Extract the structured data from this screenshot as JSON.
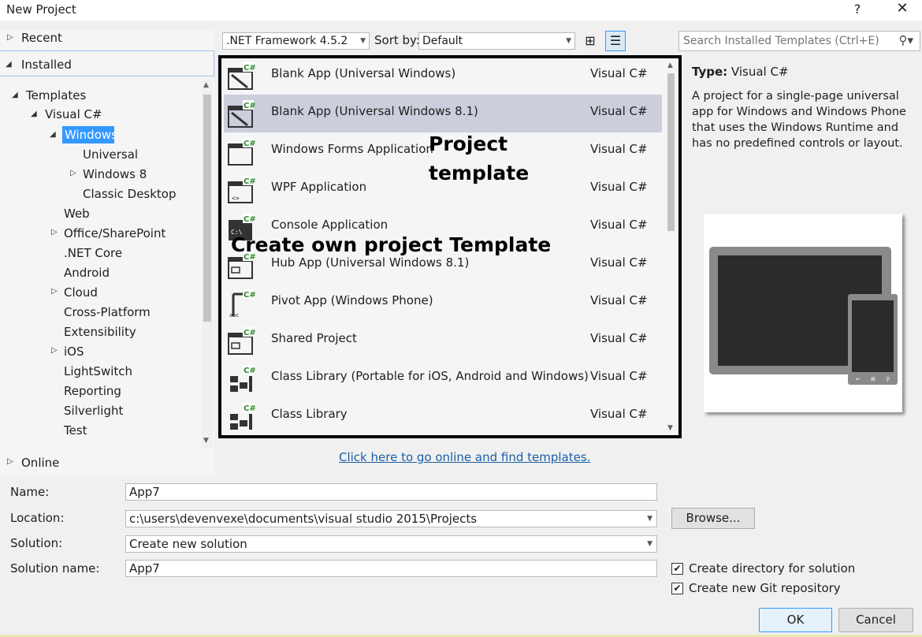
{
  "window": {
    "title": "New Project",
    "help": "?",
    "close": "✕"
  },
  "tree": {
    "recent": "Recent",
    "installed": "Installed",
    "templates": "Templates",
    "visual_csharp": "Visual C#",
    "windows": "Windows",
    "universal": "Universal",
    "windows8": "Windows 8",
    "classic_desktop": "Classic Desktop",
    "web": "Web",
    "office_sharepoint": "Office/SharePoint",
    "net_core": ".NET Core",
    "android": "Android",
    "cloud": "Cloud",
    "cross_platform": "Cross-Platform",
    "extensibility": "Extensibility",
    "ios": "iOS",
    "lightswitch": "LightSwitch",
    "reporting": "Reporting",
    "silverlight": "Silverlight",
    "test": "Test",
    "online": "Online"
  },
  "toolbar": {
    "framework": ".NET Framework 4.5.2",
    "sort_label": "Sort by:",
    "sort_value": "Default",
    "search_placeholder": "Search Installed Templates (Ctrl+E)"
  },
  "templates": [
    {
      "name": "Blank App (Universal Windows)",
      "lang": "Visual C#"
    },
    {
      "name": "Blank App (Universal Windows 8.1)",
      "lang": "Visual C#"
    },
    {
      "name": "Windows Forms Application",
      "lang": "Visual C#"
    },
    {
      "name": "WPF Application",
      "lang": "Visual C#"
    },
    {
      "name": "Console Application",
      "lang": "Visual C#"
    },
    {
      "name": "Hub App (Universal Windows 8.1)",
      "lang": "Visual C#"
    },
    {
      "name": "Pivot App (Windows Phone)",
      "lang": "Visual C#"
    },
    {
      "name": "Shared Project",
      "lang": "Visual C#"
    },
    {
      "name": "Class Library (Portable for iOS, Android and Windows)",
      "lang": "Visual C#"
    },
    {
      "name": "Class Library",
      "lang": "Visual C#"
    }
  ],
  "annotations": {
    "project_template_1": "Project",
    "project_template_2": "template",
    "create_own": "Create own project Template"
  },
  "online_link": "Click here to go online and find templates.",
  "details": {
    "type_label": "Type:",
    "type_value": "Visual C#",
    "description": "A project for a single-page universal app for Windows and Windows Phone that uses the Windows Runtime and has no predefined controls or layout."
  },
  "form": {
    "name_label": "Name:",
    "name_value": "App7",
    "location_label": "Location:",
    "location_value": "c:\\users\\devenvexe\\documents\\visual studio 2015\\Projects",
    "solution_label": "Solution:",
    "solution_value": "Create new solution",
    "solution_name_label": "Solution name:",
    "solution_name_value": "App7",
    "browse": "Browse...",
    "create_dir": "Create directory for solution",
    "create_git": "Create new Git repository",
    "ok": "OK",
    "cancel": "Cancel"
  },
  "colors": {
    "selection": "#3399ff",
    "selected_row": "#cccedb",
    "link": "#1a5fa8",
    "csharp_badge": "#2e8b2e"
  }
}
